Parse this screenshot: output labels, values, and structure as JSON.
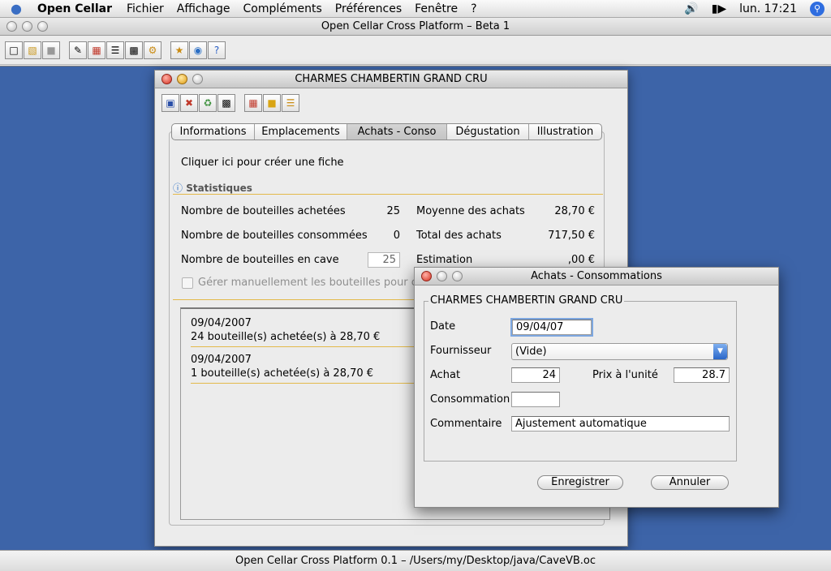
{
  "menubar": {
    "apple": "",
    "app_name": "Open Cellar",
    "items": [
      "Fichier",
      "Affichage",
      "Compléments",
      "Préférences",
      "Fenêtre",
      "?"
    ],
    "clock": "lun. 17:21"
  },
  "main_window": {
    "title": "Open Cellar Cross Platform – Beta 1",
    "status": "Open Cellar Cross Platform 0.1 –  /Users/my/Desktop/java/CaveVB.oc"
  },
  "wine_window": {
    "title": "CHARMES CHAMBERTIN GRAND CRU",
    "tabs": [
      "Informations",
      "Emplacements",
      "Achats - Conso",
      "Dégustation",
      "Illustration"
    ],
    "create_link": "Cliquer ici pour créer une fiche",
    "stats_header": "Statistiques",
    "stats": {
      "bought_label": "Nombre de bouteilles achetées",
      "bought_value": "25",
      "consumed_label": "Nombre de bouteilles consommées",
      "consumed_value": "0",
      "in_cellar_label": "Nombre de bouteilles en cave",
      "in_cellar_value": "25",
      "avg_label": "Moyenne des achats",
      "avg_value": "28,70 €",
      "total_label": "Total des achats",
      "total_value": "717,50 €",
      "estimate_label": "Estimation",
      "estimate_value": ",00 €"
    },
    "manual_label": "Gérer manuellement les bouteilles pour ce",
    "entries": [
      {
        "date": "09/04/2007",
        "text": "24 bouteille(s) achetée(s) à 28,70 €"
      },
      {
        "date": "09/04/2007",
        "text": "1 bouteille(s) achetée(s) à 28,70 €"
      }
    ]
  },
  "dialog": {
    "title": "Achats - Consommations",
    "group_title": "CHARMES CHAMBERTIN GRAND CRU",
    "date_label": "Date",
    "date_value": "09/04/07",
    "supplier_label": "Fournisseur",
    "supplier_value": "(Vide)",
    "purchase_label": "Achat",
    "purchase_value": "24",
    "unit_price_label": "Prix à l'unité",
    "unit_price_value": "28.7",
    "consumption_label": "Consommation",
    "consumption_value": "",
    "comment_label": "Commentaire",
    "comment_value": "Ajustement automatique",
    "save_label": "Enregistrer",
    "cancel_label": "Annuler"
  },
  "colors": {
    "desktop": "#3d64a8",
    "accent_line": "#e3b94a"
  }
}
